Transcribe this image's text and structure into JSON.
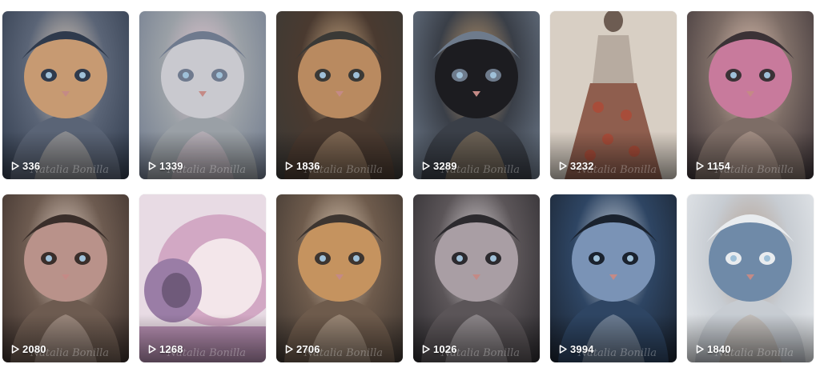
{
  "gallery": {
    "tiles": [
      {
        "views": "336",
        "subject": "cat with blue mask headdress",
        "palette": [
          "#5a6476",
          "#c79a72",
          "#2f3a4c",
          "#e8d6c2"
        ]
      },
      {
        "views": "1339",
        "subject": "winged kitten creature in silver suit",
        "palette": [
          "#9aa0a6",
          "#c9c9cf",
          "#6f7a8e",
          "#e7c8d4"
        ]
      },
      {
        "views": "1836",
        "subject": "tabby cat in ornate robe",
        "palette": [
          "#4a3a30",
          "#b98a60",
          "#3a3936",
          "#d6b48c"
        ]
      },
      {
        "views": "3289",
        "subject": "black cat with jeweled turban",
        "palette": [
          "#3a3f48",
          "#1c1c20",
          "#6e7b8c",
          "#c8a070"
        ]
      },
      {
        "views": "3232",
        "subject": "patchwork gown figure",
        "palette": [
          "#b7aba0",
          "#8f5e4e",
          "#d8cfc4",
          "#a84d3a"
        ]
      },
      {
        "views": "1154",
        "subject": "girl with cat and guitar",
        "palette": [
          "#7d6d66",
          "#c87a9c",
          "#3b3236",
          "#e3c6b6"
        ]
      },
      {
        "views": "2080",
        "subject": "cat with red headdress and beads",
        "palette": [
          "#6d5b50",
          "#b9928a",
          "#3a2e2a",
          "#e7d5c9"
        ]
      },
      {
        "views": "1268",
        "subject": "pink shell-shaped building",
        "palette": [
          "#9a7da6",
          "#d2a8c4",
          "#e8dbe4",
          "#6f5a7a"
        ]
      },
      {
        "views": "2706",
        "subject": "ginger kitten in embroidered coat",
        "palette": [
          "#6e5b4c",
          "#c5935f",
          "#3d3530",
          "#e5d2bd"
        ]
      },
      {
        "views": "1026",
        "subject": "white cat in sequined jacket",
        "palette": [
          "#5b5558",
          "#a99ea4",
          "#2c2a2e",
          "#e2dcdf"
        ]
      },
      {
        "views": "3994",
        "subject": "blue panther with pearl crown",
        "palette": [
          "#2e4563",
          "#7a93b6",
          "#1a222e",
          "#d9dfe7"
        ]
      },
      {
        "views": "1840",
        "subject": "woman with white lace bodysuit",
        "palette": [
          "#c7ccd2",
          "#6f8aa8",
          "#e9ecef",
          "#b49d8c"
        ]
      }
    ],
    "watermark": "Natalia Bonilla",
    "accent_text_color": "#ffffff"
  }
}
